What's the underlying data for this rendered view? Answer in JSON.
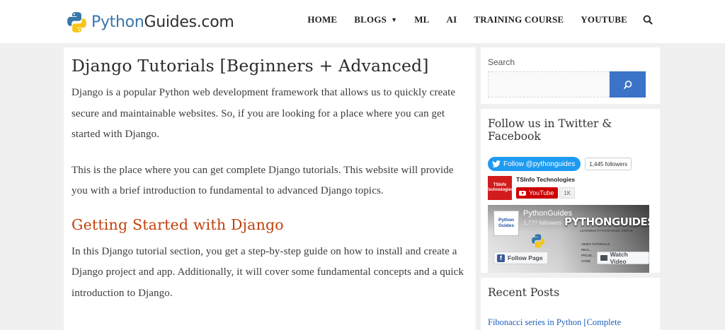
{
  "header": {
    "logo_python": "Python",
    "logo_guides": "Guides.com",
    "nav": [
      "HOME",
      "BLOGS",
      "ML",
      "AI",
      "TRAINING COURSE",
      "YOUTUBE"
    ]
  },
  "main": {
    "title": "Django Tutorials [Beginners + Advanced]",
    "paragraph_1": "Django is a popular Python web development framework that allows us to quickly create secure and maintainable websites. So, if you are looking for a place where you can get started with Django.",
    "paragraph_2": "This is the place where you can get complete Django tutorials. This website will provide you with a brief introduction to fundamental to advanced Django topics.",
    "section_title": "Getting Started with Django",
    "paragraph_3": "In this Django tutorial section, you get a step-by-step guide on how to install and create a Django project and app. Additionally, it will cover some fundamental concepts and a quick introduction to Django."
  },
  "sidebar": {
    "search_label": "Search",
    "follow_title": "Follow us in Twitter & Facebook",
    "twitter_button": "Follow @pythonguides",
    "twitter_followers": "1,445 followers",
    "youtube_logo_line1": "TSInfo",
    "youtube_logo_line2": "Technologies",
    "youtube_channel": "TSInfo Technologies",
    "youtube_button": "YouTube",
    "youtube_count": "1K",
    "fb_thumb_line1": "Python",
    "fb_thumb_line2": "Guides",
    "fb_page_name": "PythonGuides",
    "fb_followers": "1,7?? followers",
    "fb_brand": "PYTHONGUIDES.COM",
    "fb_tagline": "LEARNING PYTHON MADE SIMPLE",
    "fb_bullets": [
      "VIDEO TUTORIALS",
      "REAL...",
      "PROJE...",
      "CODE"
    ],
    "fb_follow_button": "Follow Page",
    "fb_watch_button": "Watch Video",
    "recent_title": "Recent Posts",
    "recent_post_1": "Fibonacci series in Python [Complete"
  },
  "colors": {
    "accent_blue": "#3b73c8",
    "section_orange": "#c2410c",
    "twitter": "#1d9bf0",
    "youtube": "#cc0000"
  }
}
